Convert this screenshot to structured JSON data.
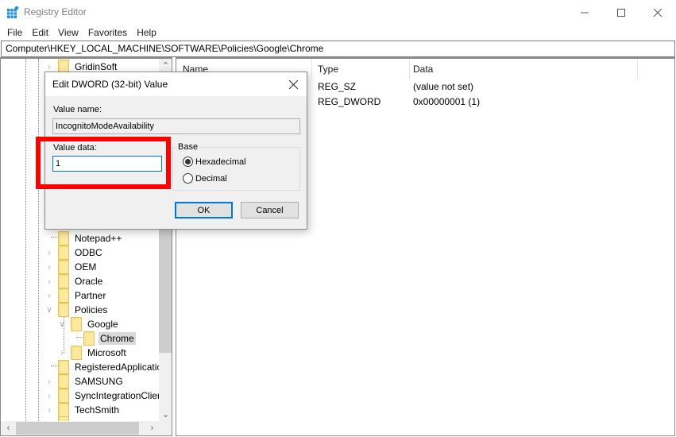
{
  "window": {
    "title": "Registry Editor",
    "app_icon": "registry-editor-icon",
    "controls": {
      "minimize": "minimize-icon",
      "maximize": "maximize-icon",
      "close": "close-icon"
    }
  },
  "menu": [
    "File",
    "Edit",
    "View",
    "Favorites",
    "Help"
  ],
  "address": "Computer\\HKEY_LOCAL_MACHINE\\SOFTWARE\\Policies\\Google\\Chrome",
  "tree": {
    "items": [
      {
        "label": "GridinSoft",
        "expander": "collapsed"
      },
      {
        "label": "Notepad++",
        "expander": "none"
      },
      {
        "label": "ODBC",
        "expander": "collapsed"
      },
      {
        "label": "OEM",
        "expander": "collapsed"
      },
      {
        "label": "Oracle",
        "expander": "collapsed"
      },
      {
        "label": "Partner",
        "expander": "collapsed"
      },
      {
        "label": "Policies",
        "expander": "expanded"
      },
      {
        "label": "Google",
        "expander": "expanded"
      },
      {
        "label": "Chrome",
        "expander": "none",
        "selected": true
      },
      {
        "label": "Microsoft",
        "expander": "collapsed"
      },
      {
        "label": "RegisteredApplicatic",
        "expander": "none"
      },
      {
        "label": "SAMSUNG",
        "expander": "collapsed"
      },
      {
        "label": "SyncIntegrationClier",
        "expander": "collapsed"
      },
      {
        "label": "TechSmith",
        "expander": "collapsed"
      },
      {
        "label": "...",
        "expander": "none"
      }
    ]
  },
  "list": {
    "columns": [
      "Name",
      "Type",
      "Data"
    ],
    "rows": [
      {
        "name": "",
        "type": "REG_SZ",
        "data": "(value not set)"
      },
      {
        "name": "",
        "type": "REG_DWORD",
        "data": "0x00000001 (1)"
      }
    ]
  },
  "dialog": {
    "title": "Edit DWORD (32-bit) Value",
    "value_name_label": "Value name:",
    "value_name": "IncognitoModeAvailability",
    "value_data_label": "Value data:",
    "value_data": "1",
    "base_label": "Base",
    "base_options": [
      {
        "label": "Hexadecimal",
        "selected": true
      },
      {
        "label": "Decimal",
        "selected": false
      }
    ],
    "ok_label": "OK",
    "cancel_label": "Cancel"
  },
  "annotation": {
    "color": "#ff0000",
    "target": "value-data"
  }
}
